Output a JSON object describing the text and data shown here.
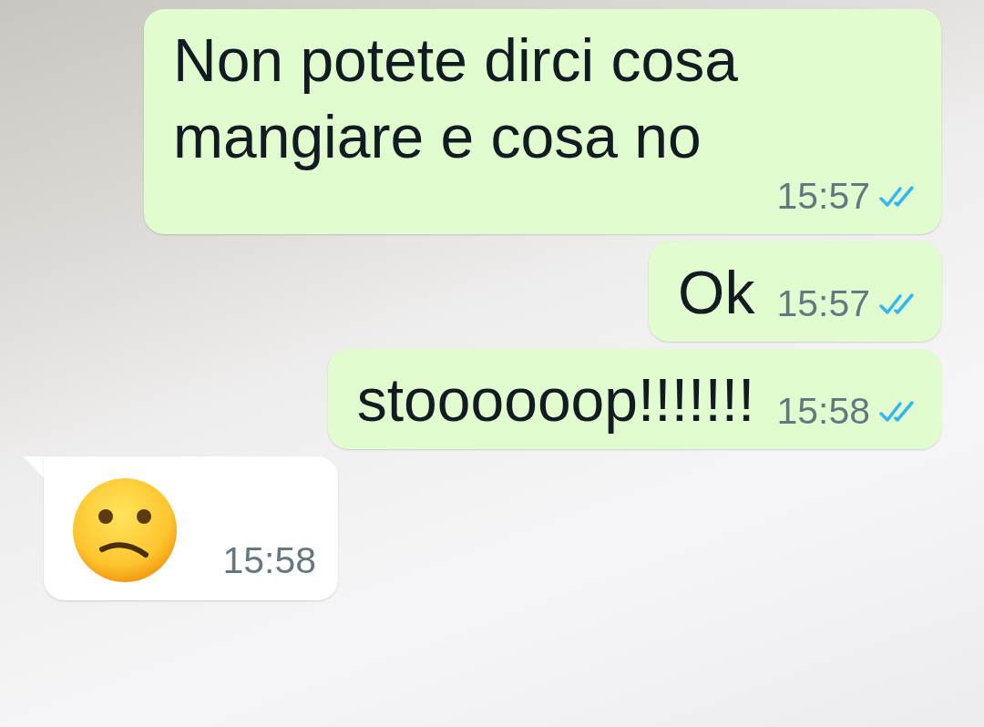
{
  "messages": [
    {
      "outgoing": true,
      "kind": "text",
      "text": "Non potete dirci cosa mangiare e cosa no",
      "time": "15:57",
      "read": true
    },
    {
      "outgoing": true,
      "kind": "text",
      "text": "Ok",
      "time": "15:57",
      "read": true
    },
    {
      "outgoing": true,
      "kind": "text",
      "text": "stoooooop!!!!!!!",
      "time": "15:58",
      "read": true
    },
    {
      "outgoing": false,
      "kind": "emoji",
      "time": "15:58"
    }
  ]
}
